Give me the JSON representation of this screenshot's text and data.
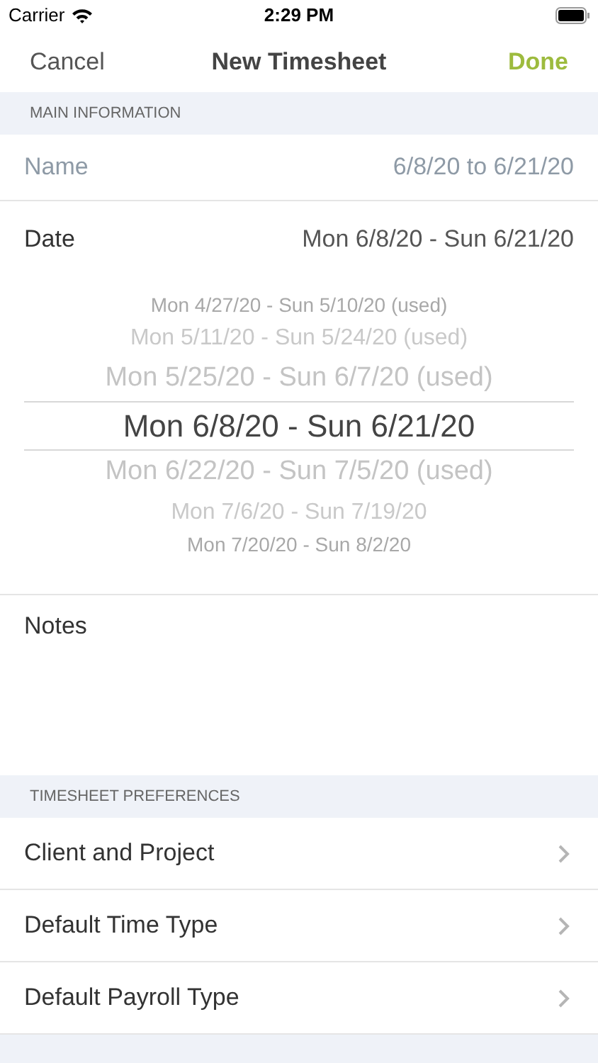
{
  "status_bar": {
    "carrier": "Carrier",
    "time": "2:29 PM"
  },
  "nav": {
    "cancel": "Cancel",
    "title": "New Timesheet",
    "done": "Done"
  },
  "main_section": {
    "header": "MAIN INFORMATION",
    "name_field": {
      "placeholder": "Name",
      "suggestion": "6/8/20 to 6/21/20"
    },
    "date": {
      "label": "Date",
      "value": "Mon 6/8/20 - Sun 6/21/20"
    },
    "picker": [
      {
        "label": "Mon 4/27/20 - Sun 5/10/20 (used)",
        "selected": false
      },
      {
        "label": "Mon 5/11/20 - Sun 5/24/20 (used)",
        "selected": false
      },
      {
        "label": "Mon 5/25/20 - Sun 6/7/20 (used)",
        "selected": false
      },
      {
        "label": "Mon 6/8/20 - Sun 6/21/20",
        "selected": true
      },
      {
        "label": "Mon 6/22/20 - Sun 7/5/20 (used)",
        "selected": false
      },
      {
        "label": "Mon 7/6/20 - Sun 7/19/20",
        "selected": false
      },
      {
        "label": "Mon 7/20/20 - Sun 8/2/20",
        "selected": false
      }
    ],
    "notes": {
      "label": "Notes"
    }
  },
  "preferences_section": {
    "header": "TIMESHEET PREFERENCES",
    "rows": [
      {
        "label": "Client and Project"
      },
      {
        "label": "Default Time Type"
      },
      {
        "label": "Default Payroll Type"
      }
    ]
  }
}
